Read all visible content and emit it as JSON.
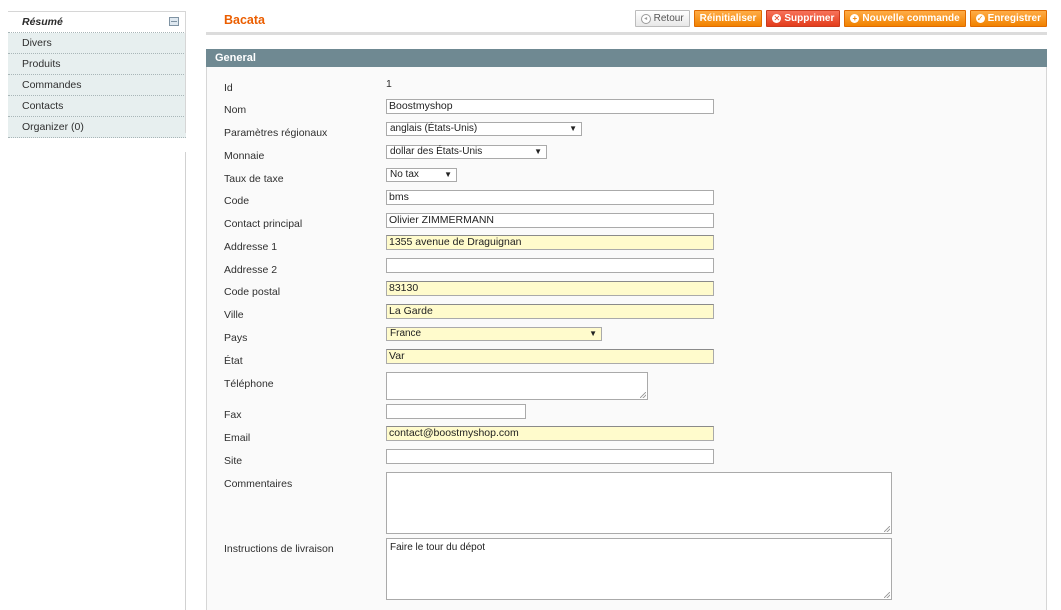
{
  "sidebar": {
    "items": [
      {
        "label": "Résumé"
      },
      {
        "label": "Divers"
      },
      {
        "label": "Produits"
      },
      {
        "label": "Commandes"
      },
      {
        "label": "Contacts"
      },
      {
        "label": "Organizer (0)"
      }
    ]
  },
  "header": {
    "title": "Bacata",
    "buttons": {
      "back": "Retour",
      "reset": "Réinitialiser",
      "delete": "Supprimer",
      "new_order": "Nouvelle commande",
      "save": "Enregistrer"
    }
  },
  "section": {
    "title": "General"
  },
  "form": {
    "id": {
      "label": "Id",
      "value": "1"
    },
    "name": {
      "label": "Nom",
      "value": "Boostmyshop"
    },
    "locale": {
      "label": "Paramètres régionaux",
      "value": "anglais (États-Unis)"
    },
    "currency": {
      "label": "Monnaie",
      "value": "dollar des États-Unis"
    },
    "tax_rate": {
      "label": "Taux de taxe",
      "value": "No tax"
    },
    "code": {
      "label": "Code",
      "value": "bms"
    },
    "main_contact": {
      "label": "Contact principal",
      "value": "Olivier ZIMMERMANN"
    },
    "address1": {
      "label": "Addresse 1",
      "value": "1355 avenue de Draguignan"
    },
    "address2": {
      "label": "Addresse 2",
      "value": ""
    },
    "postcode": {
      "label": "Code postal",
      "value": "83130"
    },
    "city": {
      "label": "Ville",
      "value": "La Garde"
    },
    "country": {
      "label": "Pays",
      "value": "France"
    },
    "state": {
      "label": "État",
      "value": "Var"
    },
    "phone": {
      "label": "Téléphone",
      "value": ""
    },
    "fax": {
      "label": "Fax",
      "value": ""
    },
    "email": {
      "label": "Email",
      "value": "contact@boostmyshop.com"
    },
    "website": {
      "label": "Site",
      "value": ""
    },
    "comments": {
      "label": "Commentaires",
      "value": ""
    },
    "delivery": {
      "label": "Instructions de livraison",
      "value": "Faire le tour du dépot"
    }
  },
  "colors": {
    "accent": "#eb5e00",
    "button_orange": "#f18200",
    "button_delete": "#e33c1c",
    "section_header": "#6f8992",
    "required_field": "#fffbcc"
  },
  "icons": {
    "back": "back-circle-icon",
    "delete": "delete-x-icon",
    "new_order": "plus-circle-icon",
    "save": "check-circle-icon",
    "collapse": "collapse-icon"
  }
}
